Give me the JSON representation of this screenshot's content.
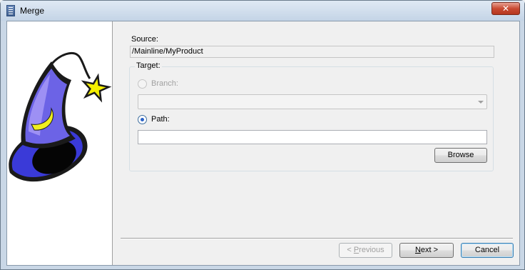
{
  "window": {
    "title": "Merge",
    "close_glyph": "✕"
  },
  "source": {
    "label": "Source:",
    "value": "/Mainline/MyProduct"
  },
  "target": {
    "label": "Target:",
    "branch_label": "Branch:",
    "branch_selected": false,
    "branch_value": "",
    "path_label": "Path:",
    "path_selected": true,
    "path_value": ""
  },
  "buttons": {
    "browse": "Browse",
    "previous_prefix": "< ",
    "previous_key": "P",
    "previous_rest": "revious",
    "next_key": "N",
    "next_rest": "ext >",
    "cancel": "Cancel"
  },
  "icons": {
    "window_icon": "wizard-window-icon",
    "side_art": "wizard-hat-icon"
  },
  "colors": {
    "hat_blue": "#4a4ae0",
    "hat_light": "#8c7ef0",
    "star_yellow": "#f5f000",
    "radio_accent": "#2a62c7"
  }
}
